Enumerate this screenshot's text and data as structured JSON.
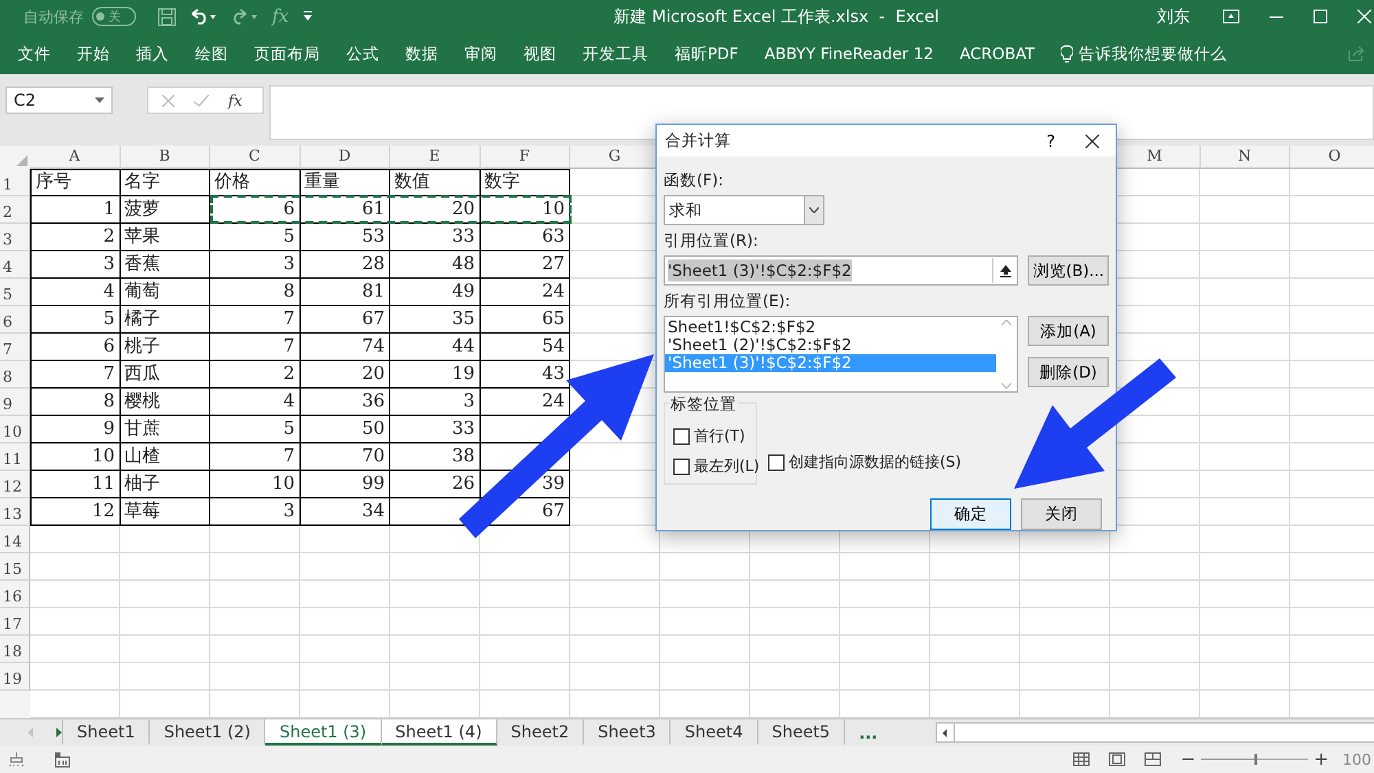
{
  "title_bar": {
    "autosave_label": "自动保存",
    "autosave_toggle": {
      "label": "关",
      "on": false
    },
    "formula_button": "fx",
    "title": "新建 Microsoft Excel 工作表.xlsx  -  Excel",
    "user": "刘东"
  },
  "ribbon_tabs": [
    "文件",
    "开始",
    "插入",
    "绘图",
    "页面布局",
    "公式",
    "数据",
    "审阅",
    "视图",
    "开发工具",
    "福昕PDF",
    "ABBYY FineReader 12",
    "ACROBAT"
  ],
  "tell_me": "告诉我你想要做什么",
  "formula_bar": {
    "name_box": "C2",
    "function_button": "fx"
  },
  "sheet": {
    "column_headers": [
      "A",
      "B",
      "C",
      "D",
      "E",
      "F",
      "G"
    ],
    "right_column_headers": [
      "M",
      "N",
      "O"
    ],
    "row_numbers": [
      "1",
      "2",
      "3",
      "4",
      "5",
      "6",
      "7",
      "8",
      "9",
      "10",
      "11",
      "12",
      "13",
      "14",
      "15",
      "16",
      "17",
      "18",
      "19"
    ],
    "rows": [
      [
        "序号",
        "名字",
        "价格",
        "重量",
        "数值",
        "数字"
      ],
      [
        "1",
        "菠萝",
        "6",
        "61",
        "20",
        "10"
      ],
      [
        "2",
        "苹果",
        "5",
        "53",
        "33",
        "63"
      ],
      [
        "3",
        "香蕉",
        "3",
        "28",
        "48",
        "27"
      ],
      [
        "4",
        "葡萄",
        "8",
        "81",
        "49",
        "24"
      ],
      [
        "5",
        "橘子",
        "7",
        "67",
        "35",
        "65"
      ],
      [
        "6",
        "桃子",
        "7",
        "74",
        "44",
        "54"
      ],
      [
        "7",
        "西瓜",
        "2",
        "20",
        "19",
        "43"
      ],
      [
        "8",
        "樱桃",
        "4",
        "36",
        "3",
        "24"
      ],
      [
        "9",
        "甘蔗",
        "5",
        "50",
        "33",
        null
      ],
      [
        "10",
        "山楂",
        "7",
        "70",
        "38",
        null
      ],
      [
        "11",
        "柚子",
        "10",
        "99",
        "26",
        "39"
      ],
      [
        "12",
        "草莓",
        "3",
        "34",
        null,
        "67"
      ]
    ]
  },
  "dialog": {
    "title": "合并计算",
    "help": "?",
    "function_label": "函数(F):",
    "function_value": "求和",
    "reference_label": "引用位置(R):",
    "reference_value": "'Sheet1 (3)'!$C$2:$F$2",
    "browse_button": "浏览(B)...",
    "all_references_label": "所有引用位置(E):",
    "all_references": [
      {
        "label": "Sheet1!$C$2:$F$2",
        "selected": false
      },
      {
        "label": "'Sheet1 (2)'!$C$2:$F$2",
        "selected": false
      },
      {
        "label": "'Sheet1 (3)'!$C$2:$F$2",
        "selected": true
      }
    ],
    "add_button": "添加(A)",
    "delete_button": "删除(D)",
    "labels_group": "标签位置",
    "options": [
      {
        "label": "首行(T)",
        "checked": false
      },
      {
        "label": "最左列(L)",
        "checked": false
      },
      {
        "label": "创建指向源数据的链接(S)",
        "checked": false
      }
    ],
    "ok_button": "确定",
    "close_button": "关闭"
  },
  "sheet_tabs": [
    {
      "label": "Sheet1",
      "selected": false,
      "grouped": false
    },
    {
      "label": "Sheet1 (2)",
      "selected": false,
      "grouped": false
    },
    {
      "label": "Sheet1 (3)",
      "selected": true,
      "grouped": true
    },
    {
      "label": "Sheet1 (4)",
      "selected": false,
      "grouped": true
    },
    {
      "label": "Sheet2",
      "selected": false,
      "grouped": false
    },
    {
      "label": "Sheet3",
      "selected": false,
      "grouped": false
    },
    {
      "label": "Sheet4",
      "selected": false,
      "grouped": false
    },
    {
      "label": "Sheet5",
      "selected": false,
      "grouped": false
    }
  ],
  "more_sheets": "...",
  "status_bar": {
    "zoom_out": "−",
    "zoom_in": "+",
    "zoom": {
      "level": 0.52
    },
    "zoom_reading": "100"
  }
}
